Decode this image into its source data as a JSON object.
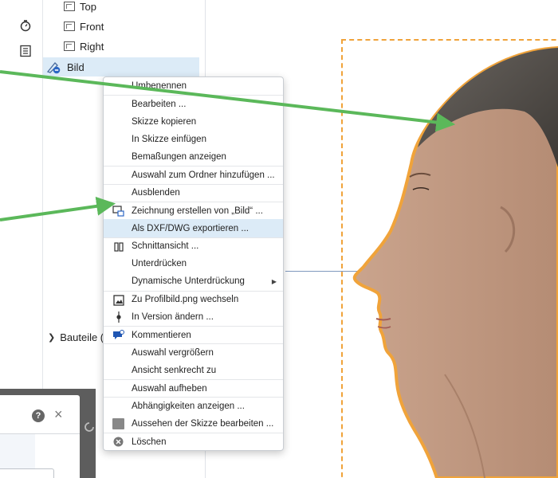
{
  "toolbar": {
    "icons": [
      "stopwatch-icon",
      "list-icon"
    ]
  },
  "tree": {
    "planes": [
      {
        "label": "Top"
      },
      {
        "label": "Front"
      },
      {
        "label": "Right"
      }
    ],
    "selected_sketch": "Bild",
    "parts_header": "Bauteile ("
  },
  "context_menu": {
    "items": [
      {
        "label": "Umbenennen",
        "icon": "",
        "separator": false
      },
      {
        "label": "Bearbeiten ...",
        "icon": "",
        "separator": true
      },
      {
        "label": "Skizze kopieren",
        "icon": "",
        "separator": false
      },
      {
        "label": "In Skizze einfügen",
        "icon": "",
        "separator": false
      },
      {
        "label": "Bemaßungen anzeigen",
        "icon": "",
        "separator": false
      },
      {
        "label": "Auswahl zum Ordner hinzufügen ...",
        "icon": "",
        "separator": true
      },
      {
        "label": "Ausblenden",
        "icon": "",
        "separator": true
      },
      {
        "label": "Zeichnung erstellen von „Bild“ ...",
        "icon": "drawing-icon",
        "separator": true
      },
      {
        "label": "Als DXF/DWG exportieren ...",
        "icon": "",
        "separator": false,
        "highlighted": true
      },
      {
        "label": "Schnittansicht ...",
        "icon": "section-view-icon",
        "separator": true
      },
      {
        "label": "Unterdrücken",
        "icon": "",
        "separator": false
      },
      {
        "label": "Dynamische Unterdrückung",
        "icon": "",
        "separator": false,
        "submenu": true
      },
      {
        "label": "Zu Profilbild.png wechseln",
        "icon": "image-icon",
        "separator": true
      },
      {
        "label": "In Version ändern ...",
        "icon": "version-icon",
        "separator": false
      },
      {
        "label": "Kommentieren",
        "icon": "comment-icon",
        "separator": true
      },
      {
        "label": "Auswahl vergrößern",
        "icon": "",
        "separator": true
      },
      {
        "label": "Ansicht senkrecht zu",
        "icon": "",
        "separator": false
      },
      {
        "label": "Auswahl aufheben",
        "icon": "",
        "separator": true
      },
      {
        "label": "Abhängigkeiten anzeigen ...",
        "icon": "",
        "separator": true
      },
      {
        "label": "Aussehen der Skizze bearbeiten ...",
        "icon": "appearance-icon",
        "separator": false
      },
      {
        "label": "Löschen",
        "icon": "delete-icon",
        "separator": true
      }
    ]
  },
  "dialog": {
    "help_icon": "help-icon",
    "close_icon": "close-icon"
  },
  "colors": {
    "arrow": "#5bb85a",
    "outline": "#f0a33a",
    "highlight": "#dcebf7"
  }
}
